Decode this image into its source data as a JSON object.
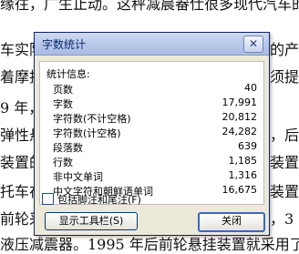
{
  "document": {
    "lines": [
      {
        "text": "缘往，广生止动。这秤减晨畚仕很多现代汽车的"
      },
      {
        "text": "车实际"
      },
      {
        "text": "着摩托"
      },
      {
        "text": "9 年，"
      },
      {
        "text": "弹性悬"
      },
      {
        "text": "装置的"
      },
      {
        "text": "托车在"
      },
      {
        "text": "前轮采"
      },
      {
        "text": "液压减震器。1995 年后前轮悬挂装置就采用了"
      }
    ],
    "right_fragments": [
      {
        "text": "的产"
      },
      {
        "text": "须提"
      },
      {
        "text": "装置"
      },
      {
        "text": "，后"
      },
      {
        "text": "装置"
      },
      {
        "text": "，3"
      }
    ]
  },
  "dialog": {
    "title": "字数统计",
    "close_glyph": "✕",
    "stats_heading": "统计信息:",
    "stats": [
      {
        "label": "页数",
        "value": "40"
      },
      {
        "label": "字数",
        "value": "17,991"
      },
      {
        "label": "字符数(不计空格)",
        "value": "20,812"
      },
      {
        "label": "字符数(计空格)",
        "value": "24,282"
      },
      {
        "label": "段落数",
        "value": "639"
      },
      {
        "label": "行数",
        "value": "1,185"
      },
      {
        "label": "非中文单词",
        "value": "1,316"
      },
      {
        "label": "中文字符和朝鲜语单词",
        "value": "16,675"
      }
    ],
    "footnote_checkbox": {
      "label": "包括脚注和尾注(F)",
      "checked": false
    },
    "buttons": {
      "toolbar": "显示工具栏(S)",
      "close": "关闭"
    }
  }
}
